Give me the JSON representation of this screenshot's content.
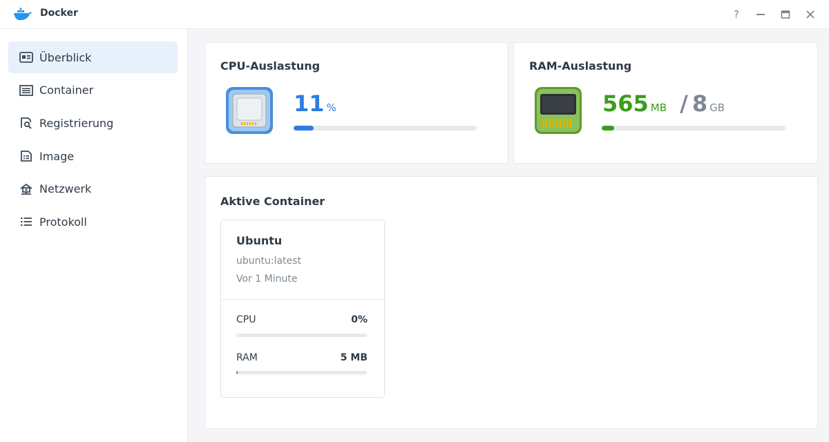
{
  "app": {
    "title": "Docker"
  },
  "window_controls": {
    "help": "?",
    "minimize": "—",
    "maximize": "▭",
    "close": "✕"
  },
  "sidebar": {
    "items": [
      {
        "label": "Überblick",
        "icon": "overview-icon",
        "active": true
      },
      {
        "label": "Container",
        "icon": "container-icon"
      },
      {
        "label": "Registrierung",
        "icon": "registry-icon"
      },
      {
        "label": "Image",
        "icon": "image-icon"
      },
      {
        "label": "Netzwerk",
        "icon": "network-icon"
      },
      {
        "label": "Protokoll",
        "icon": "log-icon"
      }
    ]
  },
  "cpu": {
    "title": "CPU-Auslastung",
    "value": "11",
    "unit": "%",
    "fraction": 0.11,
    "color": "#2e7de0"
  },
  "ram": {
    "title": "RAM-Auslastung",
    "used": "565",
    "used_unit": "MB",
    "separator": "/",
    "total": "8",
    "total_unit": "GB",
    "fraction": 0.069,
    "color": "#3a9e1c"
  },
  "active": {
    "title": "Aktive Container",
    "containers": [
      {
        "name": "Ubuntu",
        "image": "ubuntu:latest",
        "age": "Vor 1 Minute",
        "cpu_label": "CPU",
        "cpu_value": "0%",
        "cpu_fraction": 0,
        "ram_label": "RAM",
        "ram_value": "5 MB",
        "ram_fraction": 0.01
      }
    ]
  }
}
